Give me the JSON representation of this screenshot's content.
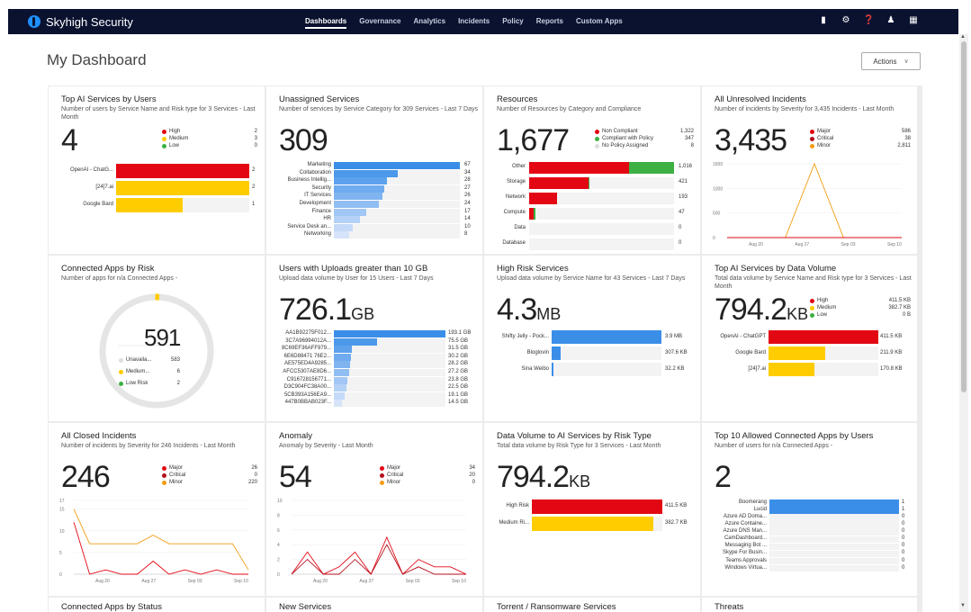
{
  "brand": "Skyhigh Security",
  "nav": [
    "Dashboards",
    "Governance",
    "Analytics",
    "Incidents",
    "Policy",
    "Reports",
    "Custom Apps"
  ],
  "page": {
    "title": "My Dashboard",
    "actions": "Actions"
  },
  "colors": {
    "high": "#e30613",
    "medium": "#ffcc00",
    "low": "#3cb043",
    "blue": "#3b8ee8",
    "orange": "#f29c11",
    "darkred": "#b50f1b",
    "nopolicy": "#dddddd"
  },
  "icons": [
    "shield-icon",
    "gear-icon",
    "help-icon",
    "user-icon",
    "apps-grid-icon"
  ],
  "cards": {
    "c1": {
      "title": "Top AI Services by Users",
      "sub": "Number of users by Service Name and Risk type for 3 Services - Last Month",
      "big": "4",
      "legend": [
        {
          "name": "High",
          "value": "2",
          "c": "#e30613"
        },
        {
          "name": "Medium",
          "value": "3",
          "c": "#ffcc00"
        },
        {
          "name": "Low",
          "value": "0",
          "c": "#3cb043"
        }
      ],
      "bars": [
        {
          "label": "OpenAI - ChatG...",
          "value": "2",
          "v": 2,
          "c": "#e30613"
        },
        {
          "label": "[24]7.ai",
          "value": "2",
          "v": 2,
          "c": "#ffcc00"
        },
        {
          "label": "Google Bard",
          "value": "1",
          "v": 1,
          "c": "#ffcc00"
        }
      ],
      "max": 2
    },
    "c2": {
      "title": "Unassigned Services",
      "sub": "Number of services by Service Category for 309 Services - Last 7 Days",
      "big": "309",
      "bars": [
        {
          "label": "Marketing",
          "value": "67",
          "v": 67
        },
        {
          "label": "Collaboration",
          "value": "34",
          "v": 34
        },
        {
          "label": "Business Intellig...",
          "value": "28",
          "v": 28
        },
        {
          "label": "Security",
          "value": "27",
          "v": 27
        },
        {
          "label": "IT Services",
          "value": "26",
          "v": 26
        },
        {
          "label": "Development",
          "value": "24",
          "v": 24
        },
        {
          "label": "Finance",
          "value": "17",
          "v": 17
        },
        {
          "label": "HR",
          "value": "14",
          "v": 14
        },
        {
          "label": "Service Desk an...",
          "value": "10",
          "v": 10
        },
        {
          "label": "Networking",
          "value": "8",
          "v": 8
        }
      ],
      "max": 67
    },
    "c3": {
      "title": "Resources",
      "sub": "Number of Resources by Category and Compliance",
      "big": "1,677",
      "legend": [
        {
          "name": "Non Compliant",
          "value": "1,322",
          "c": "#e30613"
        },
        {
          "name": "Compliant with Policy",
          "value": "347",
          "c": "#3cb043"
        },
        {
          "name": "No Policy Assigned",
          "value": "8",
          "c": "#dddddd"
        }
      ],
      "bars": [
        {
          "label": "Other",
          "value": "1,016",
          "nc": 701,
          "cp": 315
        },
        {
          "label": "Storage",
          "value": "421",
          "nc": 415,
          "cp": 6
        },
        {
          "label": "Network",
          "value": "193",
          "nc": 193,
          "cp": 0
        },
        {
          "label": "Compute",
          "value": "47",
          "nc": 30,
          "cp": 17
        },
        {
          "label": "Data",
          "value": "0",
          "nc": 0,
          "cp": 0
        },
        {
          "label": "Database",
          "value": "0",
          "nc": 0,
          "cp": 0
        }
      ],
      "max": 1016
    },
    "c4": {
      "title": "All Unresolved Incidents",
      "sub": "Number of incidents by Severity for 3,435 Incidents - Last Month",
      "big": "3,435",
      "legend": [
        {
          "name": "Major",
          "value": "586",
          "c": "#e30613"
        },
        {
          "name": "Critical",
          "value": "38",
          "c": "#b50f1b"
        },
        {
          "name": "Minor",
          "value": "2,811",
          "c": "#f29c11"
        }
      ],
      "yticks": [
        "1500",
        "1000",
        "500",
        "0"
      ],
      "xticks": [
        "Aug 20",
        "Aug 27",
        "Sep 03",
        "Sep 10"
      ]
    },
    "c5": {
      "title": "Connected Apps by Risk",
      "sub": "Number of apps for n/a Connected Apps -",
      "big": "591",
      "legend": [
        {
          "name": "Unavaila...",
          "value": "583",
          "c": "#dddddd"
        },
        {
          "name": "Medium...",
          "value": "6",
          "c": "#ffcc00"
        },
        {
          "name": "Low Risk",
          "value": "2",
          "c": "#3cb043"
        }
      ]
    },
    "c6": {
      "title": "Users with Uploads greater than 10 GB",
      "sub": "Upload data volume by User for 15 Users - Last 7 Days",
      "big": "726.1",
      "unit": "GB",
      "bars": [
        {
          "label": "AA1B92275F012...",
          "value": "193.1 GB",
          "v": 193.1
        },
        {
          "label": "3C7A96994012A...",
          "value": "75.5 GB",
          "v": 75.5
        },
        {
          "label": "8C69EF36AFF979...",
          "value": "31.5 GB",
          "v": 31.5
        },
        {
          "label": "6E6D88471 76E2...",
          "value": "30.2 GB",
          "v": 30.2
        },
        {
          "label": "AE575ED4A9285...",
          "value": "28.2 GB",
          "v": 28.2
        },
        {
          "label": "AFCC5307AE8D6...",
          "value": "27.2 GB",
          "v": 27.2
        },
        {
          "label": "C916728156771...",
          "value": "23.8 GB",
          "v": 23.8
        },
        {
          "label": "D3C904FC38A00...",
          "value": "22.5 GB",
          "v": 22.5
        },
        {
          "label": "5CB393A156EA9...",
          "value": "19.1 GB",
          "v": 19.1
        },
        {
          "label": "447B0BBAB023F...",
          "value": "14.5 GB",
          "v": 14.5
        }
      ],
      "max": 193.1
    },
    "c7": {
      "title": "High Risk Services",
      "sub": "Upload data volume by Service Name for 43 Services - Last 7 Days",
      "big": "4.3",
      "unit": "MB",
      "bars": [
        {
          "label": "Shifty Jelly - Pock...",
          "value": "3.9 MB",
          "v": 3900
        },
        {
          "label": "Bloglovin",
          "value": "307.6 KB",
          "v": 307.6
        },
        {
          "label": "Sina Weibo",
          "value": "32.2 KB",
          "v": 32.2
        }
      ],
      "max": 3900
    },
    "c8": {
      "title": "Top AI Services by Data Volume",
      "sub": "Total data volume by Service Name and Risk type for 3 Services - Last Month",
      "big": "794.2",
      "unit": "KB",
      "legend": [
        {
          "name": "High",
          "value": "411.5 KB",
          "c": "#e30613"
        },
        {
          "name": "Medium",
          "value": "382.7 KB",
          "c": "#ffcc00"
        },
        {
          "name": "Low",
          "value": "0 B",
          "c": "#3cb043"
        }
      ],
      "bars": [
        {
          "label": "OpenAI - ChatGPT",
          "value": "411.5 KB",
          "v": 411.5,
          "c": "#e30613"
        },
        {
          "label": "Google Bard",
          "value": "211.9 KB",
          "v": 211.9,
          "c": "#ffcc00"
        },
        {
          "label": "[24]7.ai",
          "value": "170.8 KB",
          "v": 170.8,
          "c": "#ffcc00"
        }
      ],
      "max": 411.5
    },
    "c9": {
      "title": "All Closed Incidents",
      "sub": "Number of incidents by Severity for 246 Incidents - Last Month",
      "big": "246",
      "legend": [
        {
          "name": "Major",
          "value": "26",
          "c": "#e30613"
        },
        {
          "name": "Critical",
          "value": "0",
          "c": "#b50f1b"
        },
        {
          "name": "Minor",
          "value": "220",
          "c": "#f29c11"
        }
      ],
      "yticks": [
        "17",
        "15",
        "10",
        "5",
        "0"
      ],
      "xticks": [
        "Aug 20",
        "Aug 27",
        "Sep 03",
        "Sep 10"
      ]
    },
    "c10": {
      "title": "Anomaly",
      "sub": "Anomaly by Severity - Last Month",
      "big": "54",
      "legend": [
        {
          "name": "Major",
          "value": "34",
          "c": "#e30613"
        },
        {
          "name": "Critical",
          "value": "20",
          "c": "#b50f1b"
        },
        {
          "name": "Minor",
          "value": "0",
          "c": "#f29c11"
        }
      ],
      "yticks": [
        "10",
        "8",
        "6",
        "4",
        "2",
        "0"
      ],
      "xticks": [
        "Aug 20",
        "Aug 27",
        "Sep 03",
        "Sep 10"
      ]
    },
    "c11": {
      "title": "Data Volume to AI Services by Risk Type",
      "sub": "Total data volume by Risk Type for 3 Services - Last Month",
      "big": "794.2",
      "unit": "KB",
      "bars": [
        {
          "label": "High Risk",
          "value": "411.5 KB",
          "v": 411.5,
          "c": "#e30613"
        },
        {
          "label": "Medium Ri...",
          "value": "382.7 KB",
          "v": 382.7,
          "c": "#ffcc00"
        }
      ],
      "max": 411.5
    },
    "c12": {
      "title": "Top 10 Allowed Connected Apps by Users",
      "sub": "Number of users for n/a Connected Apps -",
      "big": "2",
      "bars": [
        {
          "label": "Boomerang",
          "value": "1",
          "v": 1
        },
        {
          "label": "Lucid",
          "value": "1",
          "v": 1
        },
        {
          "label": "Azure AD Doma...",
          "value": "0",
          "v": 0
        },
        {
          "label": "Azure Containe...",
          "value": "0",
          "v": 0
        },
        {
          "label": "Azure DNS Man...",
          "value": "0",
          "v": 0
        },
        {
          "label": "CamDashboard...",
          "value": "0",
          "v": 0
        },
        {
          "label": "Messaging Bot ...",
          "value": "0",
          "v": 0
        },
        {
          "label": "Skype For Busin...",
          "value": "0",
          "v": 0
        },
        {
          "label": "Teams Approvals",
          "value": "0",
          "v": 0
        },
        {
          "label": "Windows Virtua...",
          "value": "0",
          "v": 0
        }
      ],
      "max": 1
    },
    "c13": {
      "title": "Connected Apps by Status"
    },
    "c14": {
      "title": "New Services"
    },
    "c15": {
      "title": "Torrent / Ransomware Services"
    },
    "c16": {
      "title": "Threats"
    }
  },
  "chart_data": [
    {
      "type": "line",
      "title": "All Unresolved Incidents",
      "x": [
        "Aug 20",
        "Aug 27",
        "Sep 03",
        "Sep 10"
      ],
      "ylim": [
        0,
        1500
      ],
      "series": [
        {
          "name": "Minor",
          "values": [
            0,
            0,
            0,
            1500,
            0,
            0,
            0
          ]
        },
        {
          "name": "Major",
          "values": [
            0,
            0,
            0,
            0,
            0,
            0,
            0
          ]
        }
      ]
    },
    {
      "type": "line",
      "title": "All Closed Incidents",
      "ylim": [
        0,
        17
      ],
      "series": [
        {
          "name": "Minor",
          "values": [
            15,
            7,
            7,
            7,
            7,
            9,
            7,
            7,
            7,
            7,
            7,
            1
          ]
        },
        {
          "name": "Major",
          "values": [
            12,
            0,
            1,
            0,
            0,
            3,
            0,
            1,
            0,
            1,
            0,
            0
          ]
        }
      ]
    },
    {
      "type": "line",
      "title": "Anomaly",
      "ylim": [
        0,
        10
      ],
      "series": [
        {
          "name": "Major",
          "values": [
            0,
            3,
            0,
            1,
            3,
            0,
            5,
            0,
            2,
            1,
            1,
            0
          ]
        },
        {
          "name": "Critical",
          "values": [
            0,
            2,
            0,
            0,
            2,
            0,
            4,
            0,
            1,
            0,
            0,
            0
          ]
        }
      ]
    }
  ]
}
